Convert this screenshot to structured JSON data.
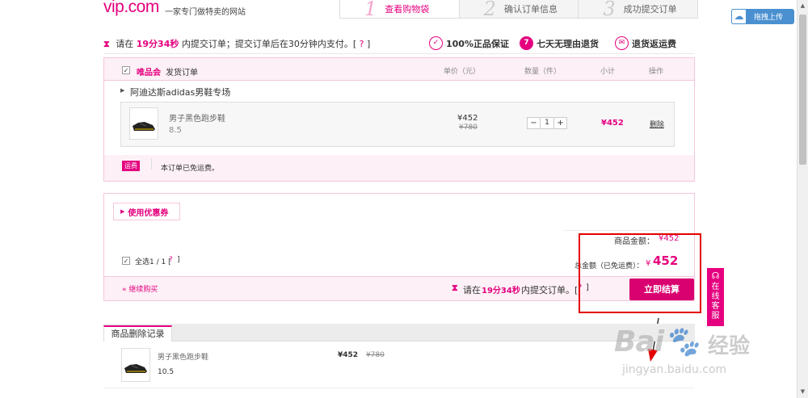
{
  "header": {
    "logo": "vip.com",
    "slogan": "一家专门做特卖的网站",
    "steps": [
      {
        "num": "1",
        "label": "查看购物袋"
      },
      {
        "num": "2",
        "label": "确认订单信息"
      },
      {
        "num": "3",
        "label": "成功提交订单"
      }
    ],
    "upload_label": "拖拽上传"
  },
  "timer": {
    "prefix": "请在",
    "time": "19分34秒",
    "suffix": "内提交订单；提交订单后在30分钟内支付。[",
    "help": "?",
    "close": "]"
  },
  "guarantees": [
    {
      "icon": "shield-icon",
      "glyph": "✓",
      "label": "100%正品保证"
    },
    {
      "icon": "seven-day-icon",
      "glyph": "7",
      "label": "七天无理由退货"
    },
    {
      "icon": "return-shipping-icon",
      "glyph": "✉",
      "label": "退货返运费"
    }
  ],
  "order": {
    "checkbox": "✓",
    "brand": "唯品会",
    "title": "发货订单",
    "columns": [
      "单价（元）",
      "数量（件）",
      "小计",
      "操作"
    ],
    "shop": "阿迪达斯adidas男鞋专场",
    "item": {
      "name": "男子黑色跑步鞋",
      "size": "8.5",
      "price": "¥452",
      "orig_price": "¥780",
      "qty_minus": "−",
      "qty": "1",
      "qty_plus": "+",
      "subtotal": "¥452",
      "delete": "删除"
    },
    "shipping_badge": "运费",
    "shipping_text": "本订单已免运费。"
  },
  "summary": {
    "coupon": "使用优惠券",
    "goods_amount_label": "商品金额：",
    "goods_amount": "¥452",
    "select_all": "全选1 / 1 [",
    "select_help": "?",
    "select_close": "]",
    "total_label": "总金额（已免运费）：",
    "total_currency": "¥",
    "total": "452",
    "continue": "« 继续购买",
    "timer_prefix": "请在",
    "timer_time": "19分34秒",
    "timer_suffix": "内提交订单。[",
    "timer_help": "?",
    "timer_close": "]",
    "checkout": "立即结算"
  },
  "service": [
    "在",
    "线",
    "客",
    "服"
  ],
  "deleted": {
    "tab": "商品删除记录",
    "item": {
      "name": "男子黑色跑步鞋",
      "size": "10.5",
      "price": "¥452",
      "orig_price": "¥780"
    }
  },
  "watermark": {
    "logo": "Bai",
    "cn": "经验",
    "url": "jingyan.baidu.com"
  },
  "colors": {
    "accent": "#e4007f",
    "highlight": "#e30000"
  }
}
